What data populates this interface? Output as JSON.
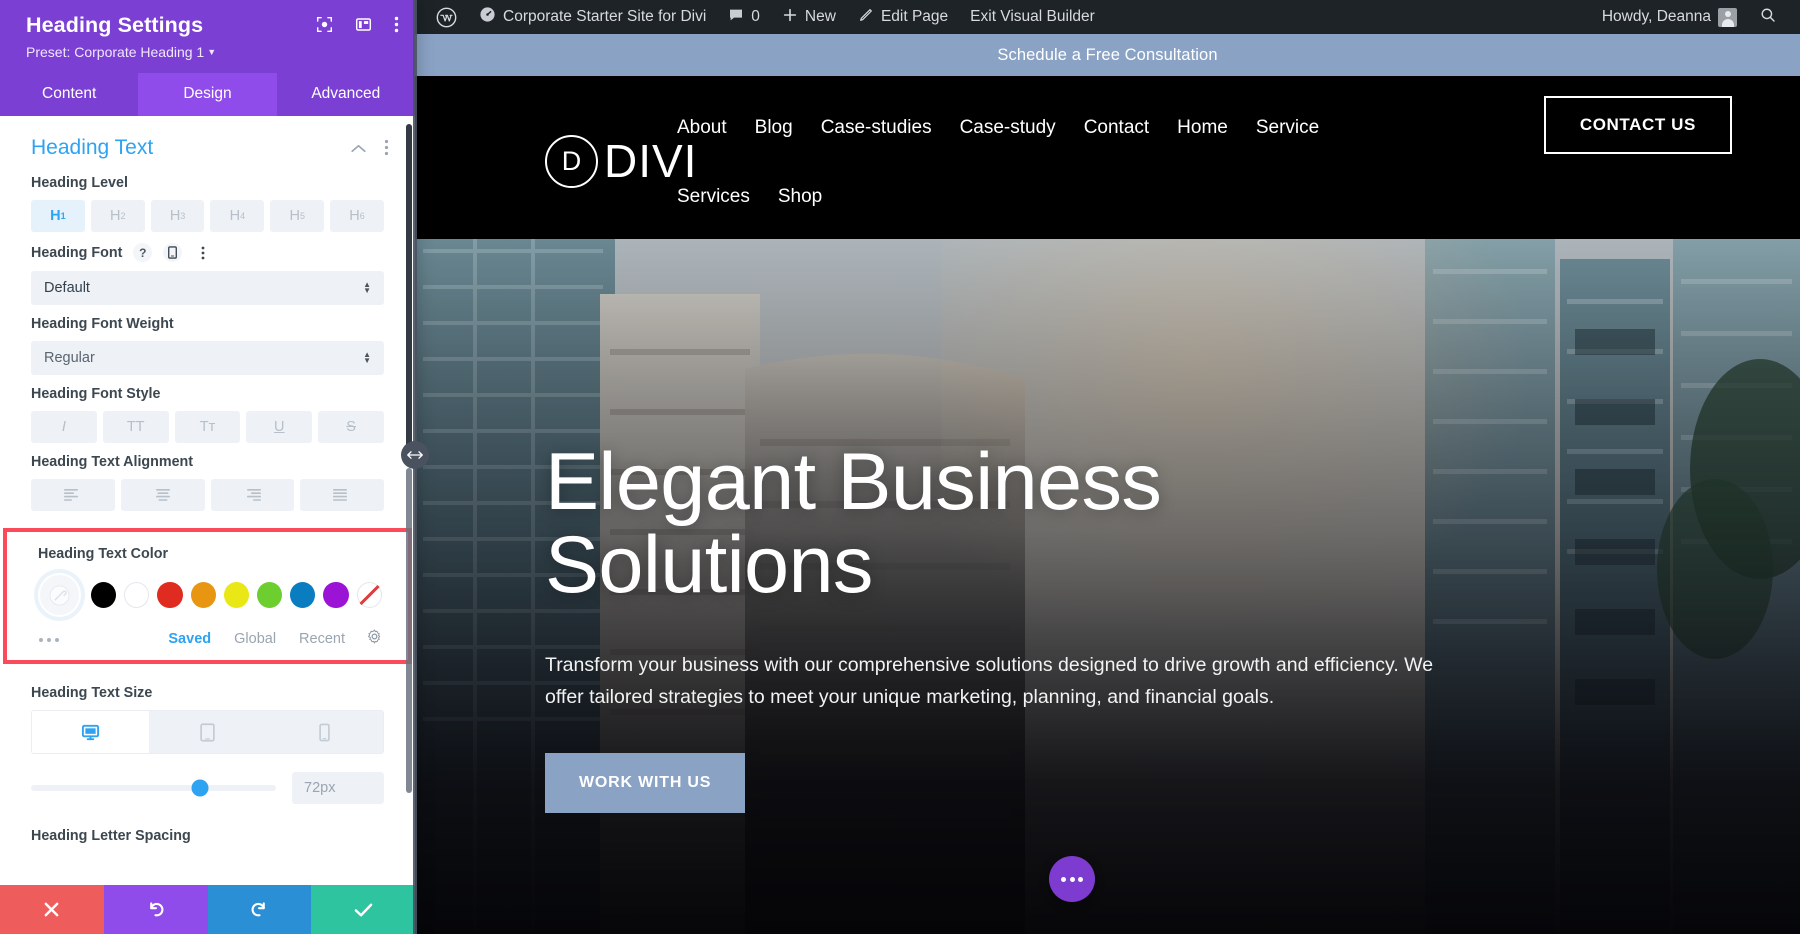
{
  "wp_admin_bar": {
    "site_icon": "wordpress-logo-icon",
    "site_name": "Corporate Starter Site for Divi",
    "comments_count": "0",
    "new_label": "New",
    "edit_page_label": "Edit Page",
    "exit_builder_label": "Exit Visual Builder",
    "howdy": "Howdy, Deanna",
    "search_icon": "search-icon"
  },
  "site": {
    "promo_bar": "Schedule a Free Consultation",
    "logo_mark": "D",
    "logo_text": "DIVI",
    "nav_primary": [
      "About",
      "Blog",
      "Case-studies",
      "Case-study",
      "Contact",
      "Home",
      "Service"
    ],
    "nav_secondary": [
      "Services",
      "Shop"
    ],
    "header_cta": "CONTACT US",
    "hero": {
      "heading_line1": "Elegant Business",
      "heading_line2": "Solutions",
      "paragraph": "Transform your business with our comprehensive solutions designed to drive growth and efficiency. We offer tailored strategies to meet your unique marketing, planning, and financial goals.",
      "cta": "WORK WITH US"
    },
    "fab": "more-options-icon"
  },
  "panel": {
    "title": "Heading Settings",
    "preset": "Preset: Corporate Heading 1",
    "header_icons": [
      "focus-target-icon",
      "layout-columns-icon",
      "kebab-menu-icon"
    ],
    "tabs": [
      {
        "label": "Content",
        "active": false
      },
      {
        "label": "Design",
        "active": true
      },
      {
        "label": "Advanced",
        "active": false
      }
    ],
    "section": {
      "title": "Heading Text",
      "collapse_icon": "chevron-up-icon",
      "menu_icon": "kebab-menu-icon"
    },
    "heading_level": {
      "label": "Heading Level",
      "options": [
        "H1",
        "H2",
        "H3",
        "H4",
        "H5",
        "H6"
      ],
      "selected": "H1"
    },
    "heading_font": {
      "label": "Heading Font",
      "icons": [
        "help-icon",
        "responsive-phone-icon",
        "kebab-menu-icon"
      ],
      "value": "Default"
    },
    "heading_font_weight": {
      "label": "Heading Font Weight",
      "value": "Regular"
    },
    "heading_font_style": {
      "label": "Heading Font Style",
      "options": [
        "italic-icon",
        "uppercase-icon",
        "small-caps-icon",
        "underline-icon",
        "strikethrough-icon"
      ],
      "glyphs": [
        "I",
        "TT",
        "Tт",
        "U",
        "S"
      ]
    },
    "heading_text_alignment": {
      "label": "Heading Text Alignment",
      "options": [
        "align-left-icon",
        "align-center-icon",
        "align-right-icon",
        "align-justify-icon"
      ]
    },
    "heading_text_color": {
      "label": "Heading Text Color",
      "highlighted": true,
      "highlight_color": "#fb4b5a",
      "selected_swatch": "picker-eyedropper-icon",
      "swatches": [
        "#000000",
        "#ffffff",
        "#e02b20",
        "#e89611",
        "#e9e715",
        "#6cce2f",
        "#0a7cc0",
        "#9b14d6",
        "none"
      ],
      "more_icon": "ellipsis-icon",
      "tabs": [
        {
          "label": "Saved",
          "active": true
        },
        {
          "label": "Global",
          "active": false
        },
        {
          "label": "Recent",
          "active": false
        }
      ],
      "settings_icon": "gear-icon"
    },
    "heading_text_size": {
      "label": "Heading Text Size",
      "devices": [
        "desktop-icon",
        "tablet-icon",
        "phone-icon"
      ],
      "active_device": "desktop-icon",
      "slider_percent": 69,
      "value": "72px"
    },
    "heading_letter_spacing": {
      "label": "Heading Letter Spacing"
    },
    "footer_buttons": [
      {
        "name": "cancel",
        "icon": "close-x-icon"
      },
      {
        "name": "undo",
        "icon": "undo-arrow-icon"
      },
      {
        "name": "redo",
        "icon": "redo-arrow-icon"
      },
      {
        "name": "save",
        "icon": "check-icon"
      }
    ],
    "resize_handle": "horizontal-resize-icon"
  }
}
